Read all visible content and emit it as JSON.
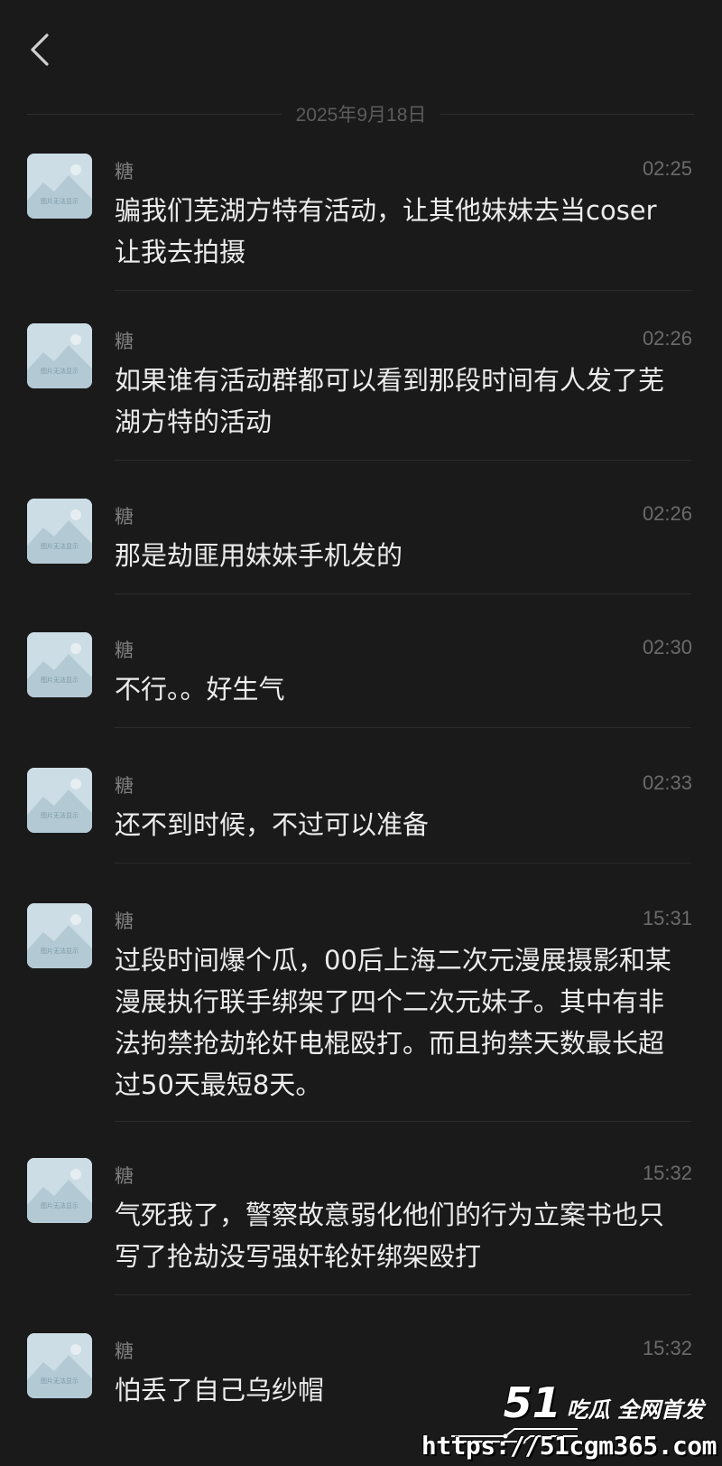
{
  "header": {
    "back_icon": "chevron-left-icon"
  },
  "date_divider": "2025年9月18日",
  "messages": [
    {
      "sender": "糖",
      "time": "02:25",
      "text": "骗我们芜湖方特有活动，让其他妹妹去当coser让我去拍摄"
    },
    {
      "sender": "糖",
      "time": "02:26",
      "text": "如果谁有活动群都可以看到那段时间有人发了芜湖方特的活动"
    },
    {
      "sender": "糖",
      "time": "02:26",
      "text": "那是劫匪用妹妹手机发的"
    },
    {
      "sender": "糖",
      "time": "02:30",
      "text": "不行。。好生气"
    },
    {
      "sender": "糖",
      "time": "02:33",
      "text": "还不到时候，不过可以准备"
    },
    {
      "sender": "糖",
      "time": "15:31",
      "text": "过段时间爆个瓜，00后上海二次元漫展摄影和某漫展执行联手绑架了四个二次元妹子。其中有非法拘禁抢劫轮奸电棍殴打。而且拘禁天数最长超过50天最短8天。"
    },
    {
      "sender": "糖",
      "time": "15:32",
      "text": "气死我了，警察故意弱化他们的行为立案书也只写了抢劫没写强奸轮奸绑架殴打"
    },
    {
      "sender": "糖",
      "time": "15:32",
      "text": "怕丢了自己乌纱帽"
    }
  ],
  "avatar": {
    "icon": "image-placeholder-icon",
    "caption": "图片无法显示"
  },
  "watermark": {
    "logo_number": "51",
    "logo_text": "吃瓜 全网首发",
    "url": "https://51cgm365.com"
  }
}
